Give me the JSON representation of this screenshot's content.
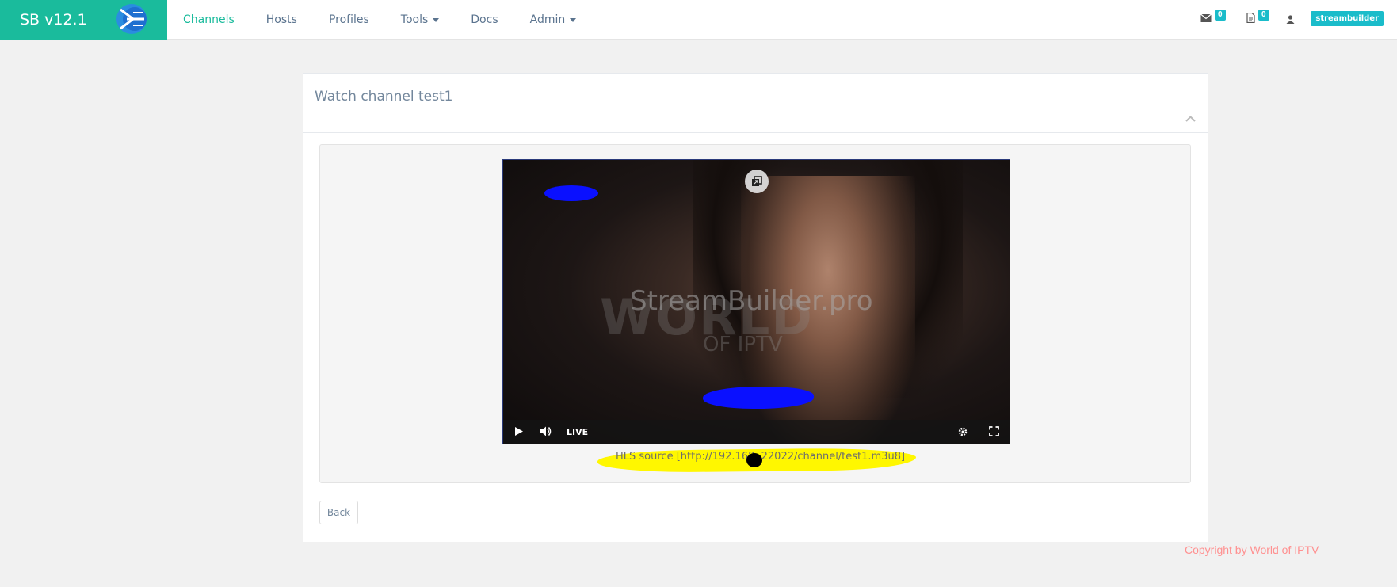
{
  "brand": {
    "title": "SB v12.1",
    "logo_icon": "streambuilder-logo-icon"
  },
  "nav": [
    {
      "label": "Channels",
      "active": true,
      "dropdown": false
    },
    {
      "label": "Hosts",
      "active": false,
      "dropdown": false
    },
    {
      "label": "Profiles",
      "active": false,
      "dropdown": false
    },
    {
      "label": "Tools",
      "active": false,
      "dropdown": true
    },
    {
      "label": "Docs",
      "active": false,
      "dropdown": false
    },
    {
      "label": "Admin",
      "active": false,
      "dropdown": true
    }
  ],
  "header_right": {
    "messages_count": "0",
    "notifications_count": "0",
    "username": "streambuilder"
  },
  "panel": {
    "title": "Watch channel test1",
    "player": {
      "watermark_brand": "StreamBuilder.pro",
      "watermark_world": "WORLD",
      "watermark_ofiptv": "OF IPTV",
      "live_label": "LIVE"
    },
    "hls_source": "HLS source [http://192.168.  22022/channel/test1.m3u8]",
    "back_label": "Back"
  },
  "footer": {
    "copyright": "Copyright by World of IPTV"
  },
  "colors": {
    "brand": "#1abb9c",
    "badge": "#1abcca",
    "highlight": "#fff700",
    "scribble": "#0a10ff"
  }
}
